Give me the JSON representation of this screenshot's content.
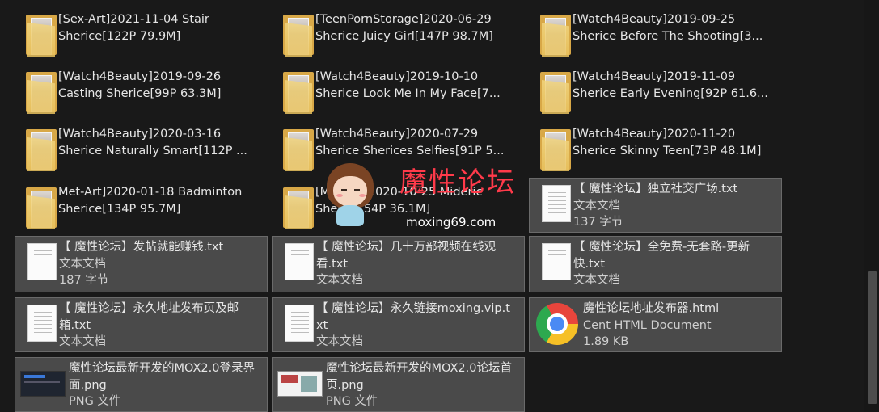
{
  "folders": [
    {
      "line1": "[Sex-Art]2021-11-04 Stair",
      "line2": "Sherice[122P 79.9M]"
    },
    {
      "line1": "[TeenPornStorage]2020-06-29",
      "line2": "Sherice Juicy Girl[147P 98.7M]"
    },
    {
      "line1": "[Watch4Beauty]2019-09-25",
      "line2": "Sherice Before The Shooting[3..."
    },
    {
      "line1": "[Watch4Beauty]2019-09-26",
      "line2": "Casting Sherice[99P 63.3M]"
    },
    {
      "line1": "[Watch4Beauty]2019-10-10",
      "line2": "Sherice Look Me In My Face[7..."
    },
    {
      "line1": "[Watch4Beauty]2019-11-09",
      "line2": "Sherice Early Evening[92P 61.6..."
    },
    {
      "line1": "[Watch4Beauty]2020-03-16",
      "line2": "Sherice Naturally Smart[112P ..."
    },
    {
      "line1": "[Watch4Beauty]2020-07-29",
      "line2": "Sherice Sherices Selfies[91P 5..."
    },
    {
      "line1": "[Watch4Beauty]2020-11-20",
      "line2": "Sherice Skinny Teen[73P 48.1M]"
    },
    {
      "line1": "Met-Art]2020-01-18 Badminton",
      "line2": "Sherice[134P 95.7M]"
    },
    {
      "line1": "[Met-Art]2020-10-25 Mideric",
      "line2": "Sherice[54P 36.1M]"
    }
  ],
  "files": [
    {
      "name": "【 魔性论坛】独立社交广场.txt",
      "type": "文本文档",
      "size": "137 字节"
    },
    {
      "name": "【 魔性论坛】发帖就能赚钱.txt",
      "type": "文本文档",
      "size": "187 字节"
    },
    {
      "name": "【 魔性论坛】几十万部视频在线观看.txt",
      "type": "文本文档"
    },
    {
      "name": "【 魔性论坛】全免费-无套路-更新快.txt",
      "type": "文本文档"
    },
    {
      "name": "【 魔性论坛】永久地址发布页及邮箱.txt",
      "type": "文本文档"
    },
    {
      "name": "【 魔性论坛】永久链接moxing.vip.txt",
      "type": "文本文档"
    },
    {
      "name": "魔性论坛地址发布器.html",
      "type": "Cent HTML Document",
      "size": "1.89 KB"
    },
    {
      "name": "魔性论坛最新开发的MOX2.0登录界面.png",
      "type": "PNG 文件"
    },
    {
      "name": "魔性论坛最新开发的MOX2.0论坛首页.png",
      "type": "PNG 文件"
    }
  ],
  "watermark": {
    "title": "魔性论坛",
    "url": "moxing69.com"
  }
}
